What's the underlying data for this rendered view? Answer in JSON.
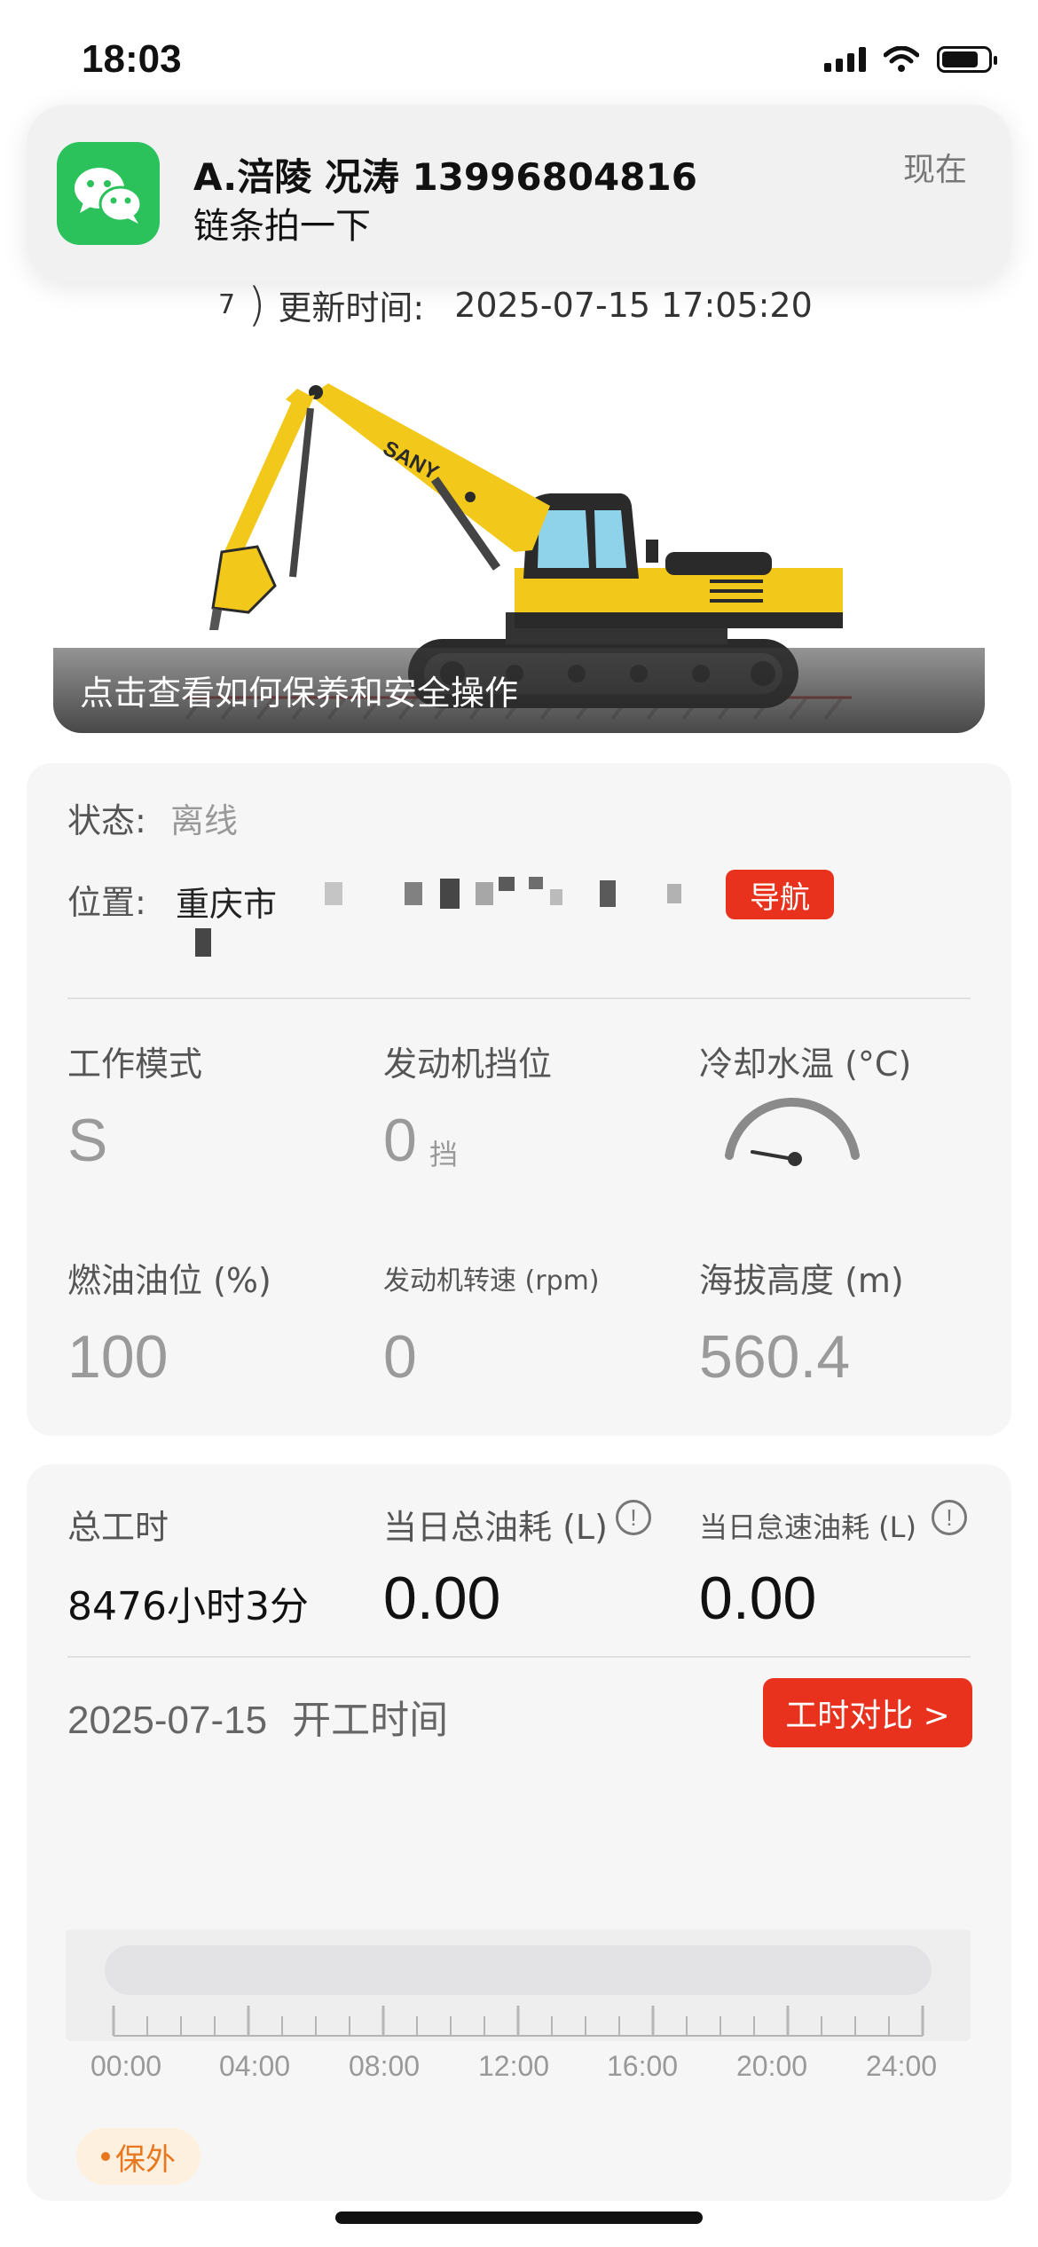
{
  "status_bar": {
    "time": "18:03"
  },
  "notification": {
    "app_icon": "wechat-icon",
    "title": "A.涪陵  况涛 13996804816",
    "body": "链条拍一下",
    "time": "现在"
  },
  "update": {
    "prefix": "7",
    "label": "更新时间:",
    "value": "2025-07-15 17:05:20"
  },
  "banner": {
    "caption": "点击查看如何保养和安全操作",
    "brand": "SANY"
  },
  "machine": {
    "status_label": "状态:",
    "status_value": "离线",
    "location_label": "位置:",
    "location_value": "重庆市",
    "nav_button": "导航"
  },
  "metrics": [
    {
      "label": "工作模式",
      "value": "S",
      "unit": ""
    },
    {
      "label": "发动机挡位",
      "value": "0",
      "unit": "挡"
    },
    {
      "label": "冷却水温 (°C)",
      "value": "",
      "unit": ""
    },
    {
      "label": "燃油油位 (%)",
      "value": "100",
      "unit": ""
    },
    {
      "label": "发动机转速 (rpm)",
      "value": "0",
      "unit": ""
    },
    {
      "label": "海拔高度 (m)",
      "value": "560.4",
      "unit": ""
    }
  ],
  "totals": {
    "total_hours_label": "总工时",
    "total_hours_value": "8476小时3分",
    "daily_fuel_label": "当日总油耗 (L)",
    "daily_fuel_value": "0.00",
    "idle_fuel_label": "当日怠速油耗 (L)",
    "idle_fuel_value": "0.00",
    "info_glyph": "!"
  },
  "worktime": {
    "date": "2025-07-15",
    "label": "开工时间",
    "compare_button": "工时对比 >",
    "ticks": [
      "00:00",
      "04:00",
      "08:00",
      "12:00",
      "16:00",
      "20:00",
      "24:00"
    ]
  },
  "tag": {
    "label": "保外"
  },
  "colors": {
    "accent_red": "#e8321e",
    "excavator_yellow": "#f2c81a",
    "wechat_green": "#2bc25b"
  }
}
